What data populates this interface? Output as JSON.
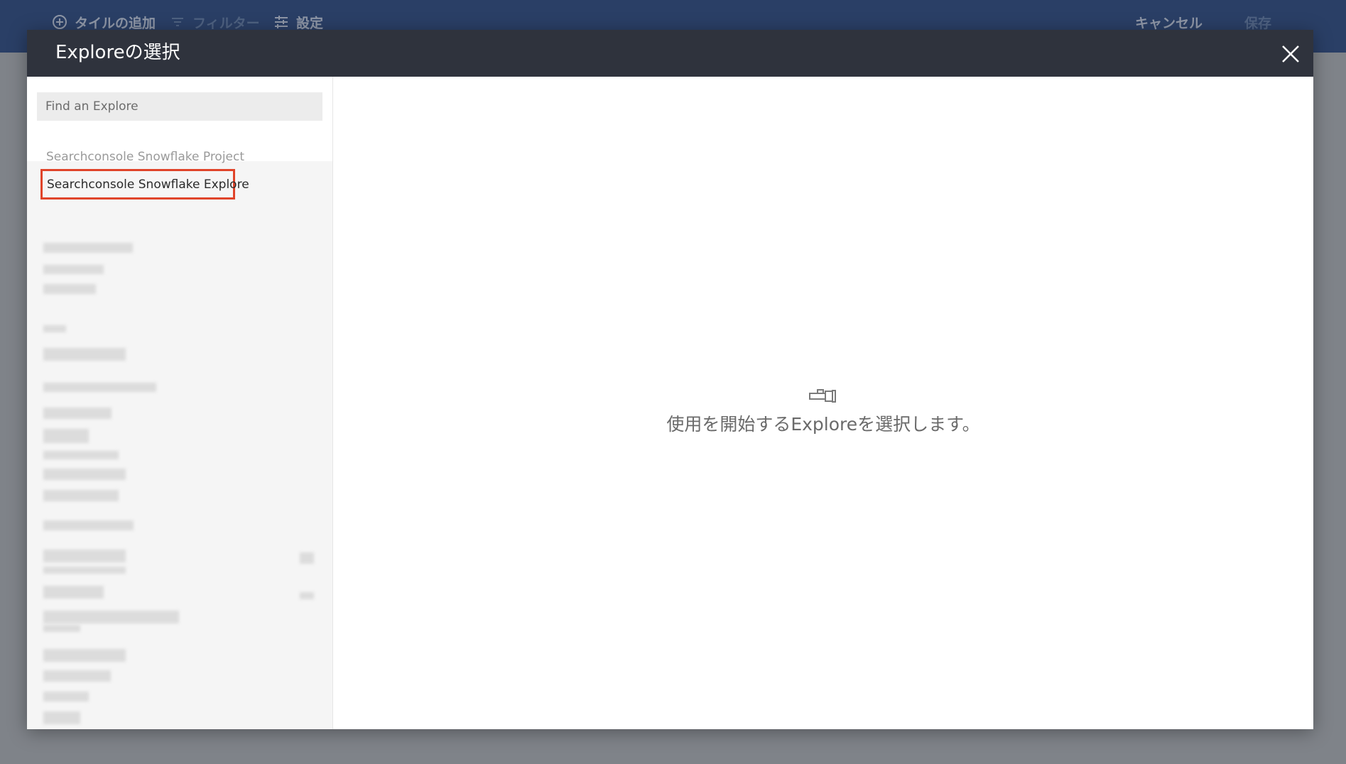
{
  "toolbar": {
    "add_tile": "タイルの追加",
    "filter": "フィルター",
    "settings": "設定",
    "cancel": "キャンセル",
    "save": "保存"
  },
  "modal": {
    "title": "Exploreの選択",
    "search": {
      "placeholder": "Find an Explore"
    },
    "project_label": "Searchconsole Snowflake Project",
    "selected_explore": "Searchconsole Snowflake Explore",
    "empty_message": "使用を開始するExploreを選択します。"
  },
  "icons": {
    "add": "add-circle-icon",
    "filter": "filter-icon",
    "settings": "sliders-icon",
    "close": "close-icon",
    "explore": "explore-telescope-icon"
  },
  "colors": {
    "toolbar_bg": "#2a3f66",
    "modal_header_bg": "#2f333d",
    "highlight_border": "#e0442a"
  }
}
